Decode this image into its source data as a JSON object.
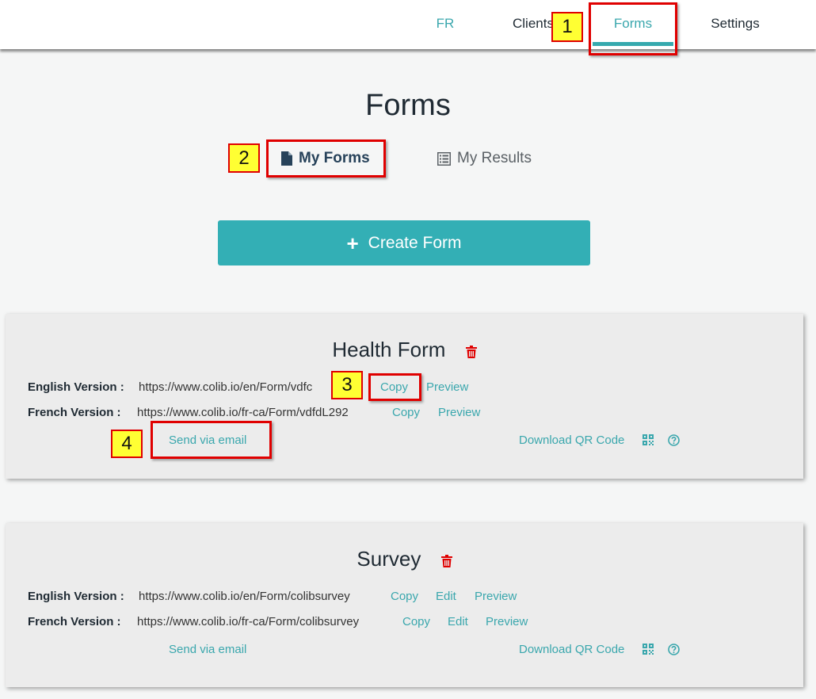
{
  "nav": {
    "lang": "FR",
    "clients": "Clients",
    "forms": "Forms",
    "settings": "Settings"
  },
  "callouts": [
    "1",
    "2",
    "3",
    "4"
  ],
  "page": {
    "title": "Forms",
    "tab_my_forms": "My Forms",
    "tab_my_results": "My Results",
    "create_button": "Create Form"
  },
  "forms": [
    {
      "title": "Health Form",
      "english_label": "English Version :",
      "english_url": "https://www.colib.io/en/Form/vdfc",
      "french_label": "French Version :",
      "french_url": "https://www.colib.io/fr-ca/Form/vdfdL292",
      "copy": "Copy",
      "preview": "Preview",
      "send_email": "Send via email",
      "download_qr": "Download QR Code"
    },
    {
      "title": "Survey",
      "english_label": "English Version :",
      "english_url": "https://www.colib.io/en/Form/colibsurvey",
      "french_label": "French Version :",
      "french_url": "https://www.colib.io/fr-ca/Form/colibsurvey",
      "copy": "Copy",
      "edit": "Edit",
      "preview": "Preview",
      "send_email": "Send via email",
      "download_qr": "Download QR Code"
    }
  ],
  "colors": {
    "accent": "#33afb5",
    "callout_border": "#e00000",
    "callout_fill": "#ffff33",
    "trash": "#e00000"
  }
}
